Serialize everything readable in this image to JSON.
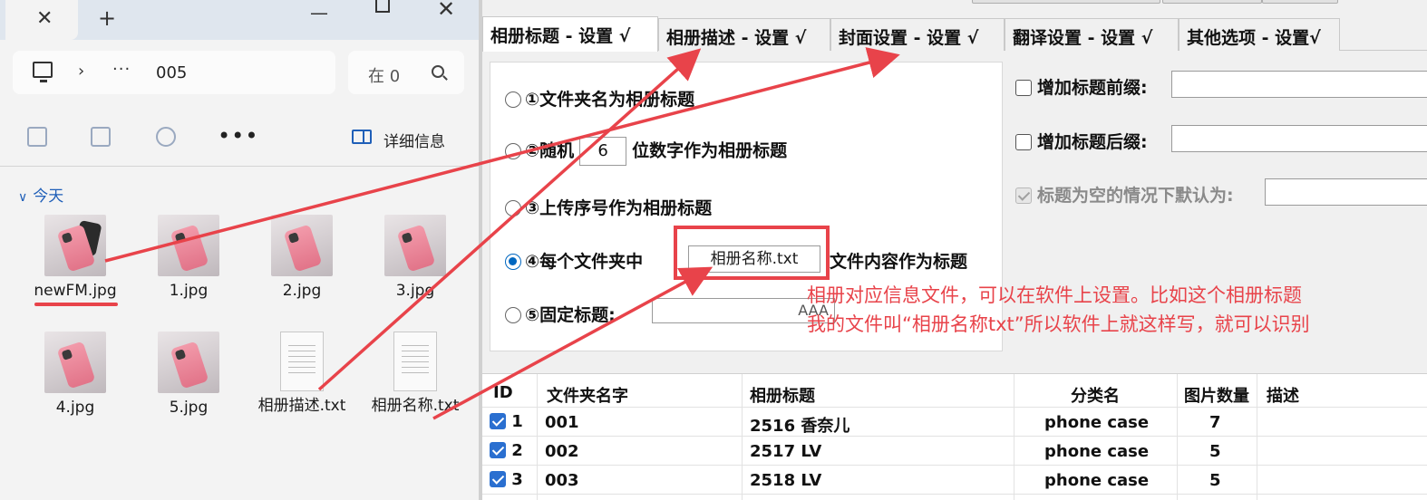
{
  "explorer": {
    "tab_close": "✕",
    "tab_new": "+",
    "address": {
      "chevron": "›",
      "dots": "···",
      "folder": "005"
    },
    "search": {
      "text": "在 0"
    },
    "toolbar": {
      "more": "•••",
      "details_label": "详细信息"
    },
    "group_label": "今天",
    "files": [
      {
        "name": "newFM.jpg",
        "kind": "image"
      },
      {
        "name": "1.jpg",
        "kind": "image"
      },
      {
        "name": "2.jpg",
        "kind": "image"
      },
      {
        "name": "3.jpg",
        "kind": "image"
      },
      {
        "name": "4.jpg",
        "kind": "image"
      },
      {
        "name": "5.jpg",
        "kind": "image"
      },
      {
        "name": "相册描述.txt",
        "kind": "text"
      },
      {
        "name": "相册名称.txt",
        "kind": "text"
      }
    ]
  },
  "app": {
    "tabs": [
      "相册标题 - 设置 √",
      "相册描述 - 设置 √",
      "封面设置 - 设置 √",
      "翻译设置 - 设置 √",
      "其他选项 - 设置√"
    ],
    "title_options": {
      "opt1": "①文件夹名为相册标题",
      "opt2_prefix": "②随机",
      "opt2_value": "6",
      "opt2_suffix": "位数字作为相册标题",
      "opt3": "③上传序号作为相册标题",
      "opt4_prefix": "④每个文件夹中",
      "opt4_file": "相册名称.txt",
      "opt4_suffix": "文件内容作为标题",
      "opt5": "⑤固定标题:",
      "opt5_value": "AAA",
      "selected": 4
    },
    "right_options": {
      "prefix_label": "增加标题前缀:",
      "suffix_label": "增加标题后缀:",
      "default_label": "标题为空的情况下默认为:"
    },
    "annotation": {
      "line1": "相册对应信息文件，可以在软件上设置。比如这个相册标题",
      "line2": "我的文件叫“相册名称txt”所以软件上就这样写，就可以识别"
    },
    "table": {
      "headers": [
        "ID",
        "文件夹名字",
        "相册标题",
        "分类名",
        "图片数量",
        "描述"
      ],
      "rows": [
        {
          "id": "1",
          "folder": "001",
          "title": "2516 香奈儿",
          "category": "phone case",
          "count": "7"
        },
        {
          "id": "2",
          "folder": "002",
          "title": "2517 LV",
          "category": "phone case",
          "count": "5"
        },
        {
          "id": "3",
          "folder": "003",
          "title": "2518 LV",
          "category": "phone case",
          "count": "5"
        }
      ]
    }
  },
  "colors": {
    "accent": "#e8434a",
    "selection": "#0067c0",
    "link": "#1f5fb8"
  }
}
